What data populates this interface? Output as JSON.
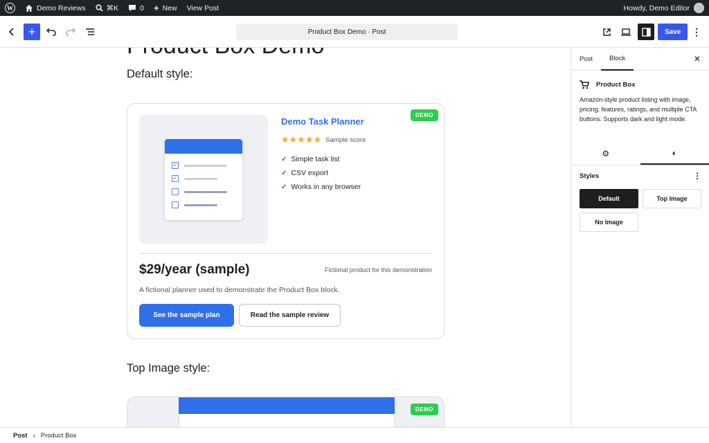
{
  "admin_bar": {
    "site_name": "Demo Reviews",
    "search_shortcut": "⌘K",
    "comments_count": "0",
    "new_label": "New",
    "view_post": "View Post",
    "greeting": "Howdy, Demo Editor"
  },
  "editor": {
    "doc_title": "Product Box Demo · Post",
    "save_label": "Save"
  },
  "canvas": {
    "cut_title": "Product Box Demo",
    "default_heading": "Default style:",
    "top_image_heading": "Top Image style:"
  },
  "product": {
    "badge": "DEMO",
    "title": "Demo Task Planner",
    "stars": "★★★★★",
    "score_label": "Sample score",
    "features": [
      "Simple task list",
      "CSV export",
      "Works in any browser"
    ],
    "price": "$29/year (sample)",
    "disclaimer": "Fictional product for this demonstration",
    "description": "A fictional planner used to demonstrate the Product Box block.",
    "primary_cta": "See the sample plan",
    "secondary_cta": "Read the sample review"
  },
  "sidebar": {
    "tabs": [
      "Post",
      "Block"
    ],
    "active_tab": "Block",
    "block_name": "Product Box",
    "block_description": "Amazon-style product listing with image, pricing, features, ratings, and multiple CTA buttons. Supports dark and light mode.",
    "styles_label": "Styles",
    "styles": [
      "Default",
      "Top Image",
      "No Image"
    ],
    "selected_style": "Default"
  },
  "footer": {
    "crumbs": [
      "Post",
      "Product Box"
    ]
  },
  "colors": {
    "wp_blue": "#3858e9",
    "product_blue": "#2f6fea",
    "badge_green": "#2ecc4f",
    "star_gold": "#f5a623",
    "admin_bar": "#1d2327"
  }
}
